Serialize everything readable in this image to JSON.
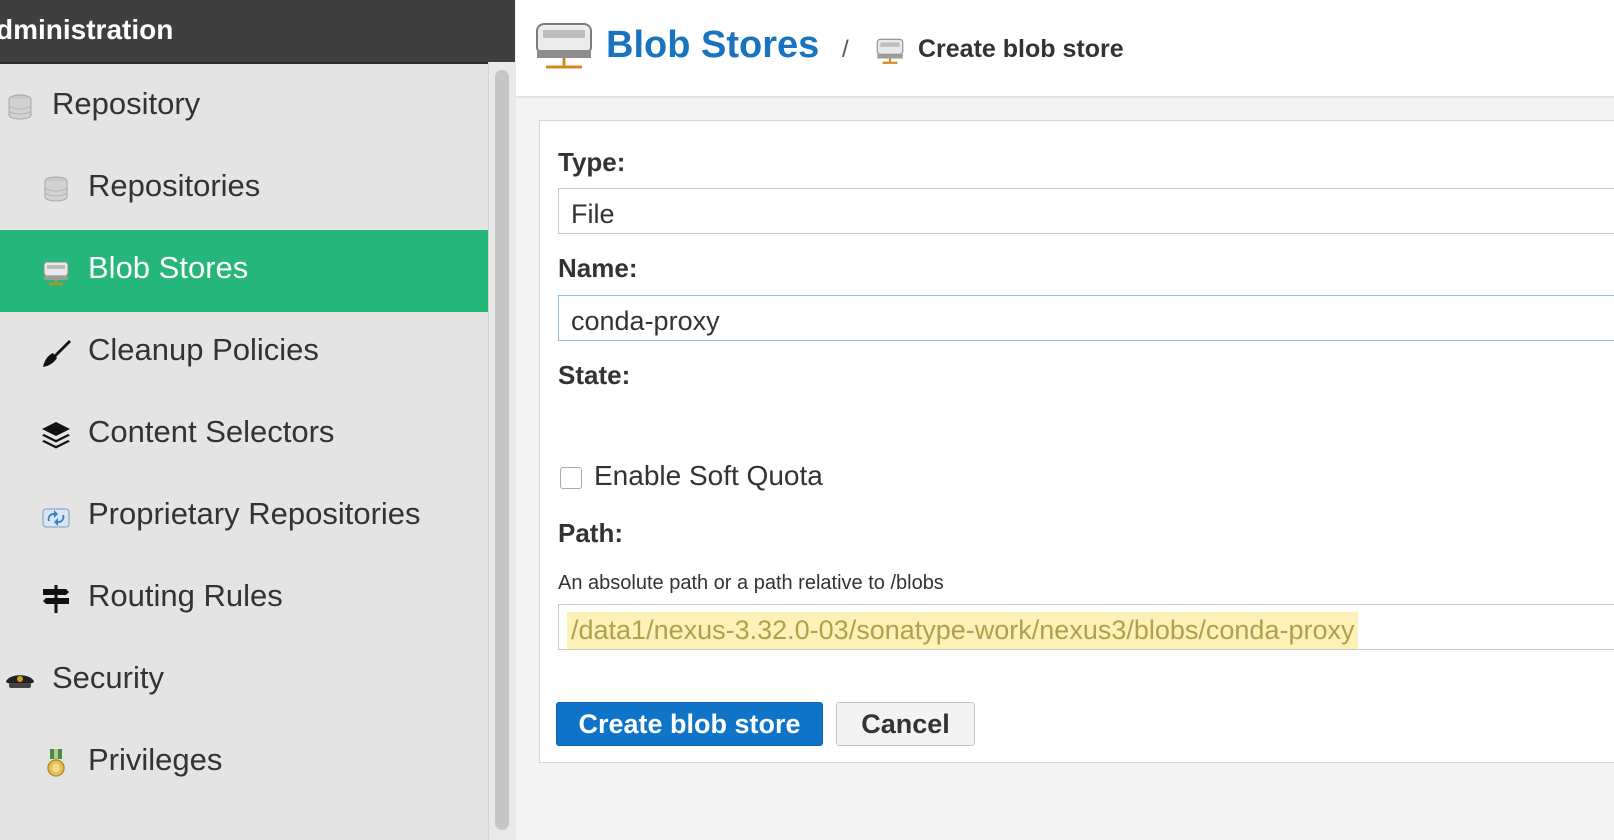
{
  "sidebar": {
    "header": "dministration",
    "items": [
      {
        "label": "Repository",
        "icon": "database-icon",
        "active": false
      },
      {
        "label": "Repositories",
        "icon": "database-icon",
        "active": false
      },
      {
        "label": "Blob Stores",
        "icon": "server-drive-icon",
        "active": true
      },
      {
        "label": "Cleanup Policies",
        "icon": "broom-icon",
        "active": false
      },
      {
        "label": "Content Selectors",
        "icon": "layers-icon",
        "active": false
      },
      {
        "label": "Proprietary Repositories",
        "icon": "recycle-icon",
        "active": false
      },
      {
        "label": "Routing Rules",
        "icon": "signpost-icon",
        "active": false
      },
      {
        "label": "Security",
        "icon": "police-hat-icon",
        "active": false
      },
      {
        "label": "Privileges",
        "icon": "medal-icon",
        "active": false
      }
    ]
  },
  "breadcrumb": {
    "title": "Blob Stores",
    "separator": "/",
    "current": "Create blob store"
  },
  "form": {
    "type_label": "Type:",
    "type_value": "File",
    "name_label": "Name:",
    "name_value": "conda-proxy",
    "state_label": "State:",
    "soft_quota_label": "Enable Soft Quota",
    "soft_quota_checked": false,
    "path_label": "Path:",
    "path_help": "An absolute path or a path relative to /blobs",
    "path_value": "/data1/nexus-3.32.0-03/sonatype-work/nexus3/blobs/conda-proxy",
    "create_button": "Create blob store",
    "cancel_button": "Cancel"
  },
  "colors": {
    "active_nav": "#25b679",
    "primary": "#0f74c8",
    "header_bg": "#3f3f3f",
    "path_highlight": "#fdf1b8"
  }
}
